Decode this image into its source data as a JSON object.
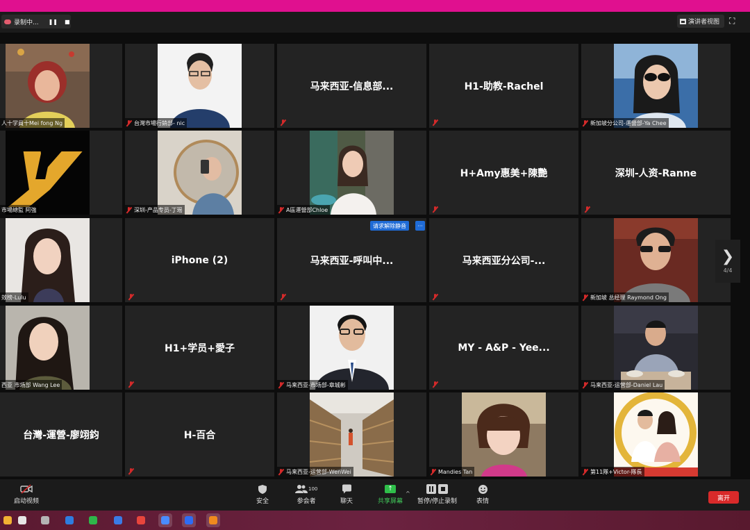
{
  "recording": {
    "label": "录制中...",
    "pause_icon": "pause-icon",
    "stop_icon": "stop-icon"
  },
  "header": {
    "speaker_view_label": "演讲者视图",
    "fullscreen_icon": "fullscreen-icon"
  },
  "tiles": [
    {
      "name": "人十学員十Mei fong Ng",
      "video": true,
      "photo": "woman-red-hair"
    },
    {
      "name": "台灣市場行銷部- nic",
      "video": true,
      "photo": "man-glasses"
    },
    {
      "name": "马来西亚-信息部...",
      "video": false
    },
    {
      "name": "H1-助教-Rachel",
      "video": false
    },
    {
      "name": "新加坡分公司-運營部-Ya Chee",
      "video": true,
      "photo": "woman-sunglasses"
    },
    {
      "name": "市場總監 阿強",
      "video": true,
      "photo": "yellow-logo"
    },
    {
      "name": "深圳-产品专员-丁瑶",
      "video": true,
      "photo": "mirror-selfie"
    },
    {
      "name": "A區運營部Chloe",
      "video": true,
      "photo": "woman-cafe"
    },
    {
      "name": "H+Amy惠美+陳艷",
      "video": false
    },
    {
      "name": "深圳-人资-Ranne",
      "video": false
    },
    {
      "name": "效榜-Lulu",
      "video": true,
      "photo": "woman-long-hair"
    },
    {
      "name": "iPhone (2)",
      "video": false
    },
    {
      "name": "马来西亚-呼叫中...",
      "video": false
    },
    {
      "name": "马来西亚分公司-...",
      "video": false
    },
    {
      "name": "新加坡 总经理 Raymond Ong",
      "video": true,
      "photo": "man-sunglasses"
    },
    {
      "name": "西亚 市场部 Wang Lee",
      "video": true,
      "photo": "woman-smiling"
    },
    {
      "name": "H1+学员+愛子",
      "video": false
    },
    {
      "name": "马来西亚-市场部-章城彬",
      "video": true,
      "photo": "man-suit"
    },
    {
      "name": "MY - A&P - Yee...",
      "video": false
    },
    {
      "name": "马来西亚-运营部-Daniel Lau",
      "video": true,
      "photo": "man-dining"
    },
    {
      "name": "台灣-運營-廖翊鈞",
      "video": false
    },
    {
      "name": "H-百合",
      "video": false
    },
    {
      "name": "马来西亚-运营部-WenWei",
      "video": true,
      "photo": "warehouse"
    },
    {
      "name": "Mandies Tan",
      "video": true,
      "photo": "woman-bangs"
    },
    {
      "name": "第11隊+Victor-隊長",
      "video": true,
      "photo": "couple-award"
    }
  ],
  "unmute_request": {
    "label": "请求解除静音",
    "more_label": "···"
  },
  "pagination": {
    "next_icon": "chevron-right-icon",
    "page_label": "4/4"
  },
  "toolbar": {
    "start_video": "启动视频",
    "security": "安全",
    "participants": "参会者",
    "participants_count": "100",
    "chat": "聊天",
    "share_screen": "共享屏幕",
    "pause_recording": "暂停/停止录制",
    "reactions": "表情",
    "leave": "离开"
  },
  "taskbar": {
    "apps": [
      "files-icon",
      "browser-icon",
      "pinwheel-icon",
      "wechat-icon",
      "wps-icon",
      "chrome-icon",
      "chart-app-icon",
      "zoom-icon",
      "media-icon"
    ]
  },
  "colors": {
    "window_border": "#e0108f",
    "tile_bg": "#232323",
    "muted_red": "#d42a2a",
    "share_green": "#2fbf4a",
    "leave_red": "#d92a2a",
    "unmute_blue": "#1f6bd6"
  }
}
